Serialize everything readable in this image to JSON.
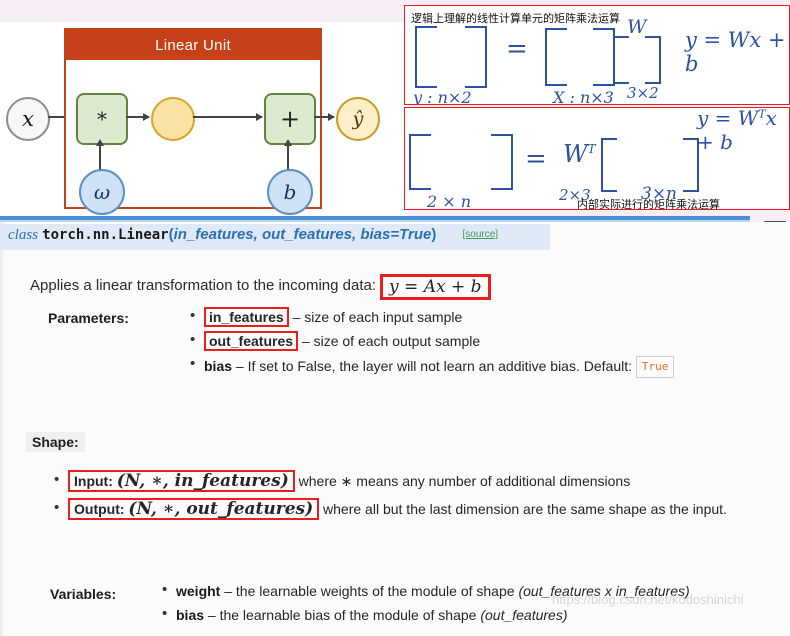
{
  "diagram": {
    "title": "Linear Unit",
    "nodes": {
      "input": "x",
      "multiply": "*",
      "hidden": "",
      "add": "+",
      "output": "ŷ",
      "weight": "ω",
      "bias": "b"
    }
  },
  "notes": {
    "note1": {
      "caption": "逻辑上理解的线性计算单元的矩阵乘法运算",
      "equals": "=",
      "w_label": "W",
      "equation": "y = Wx + b",
      "left_dim": "y : n×2",
      "mid_dim": "X : n×3",
      "right_dim": "3×2"
    },
    "note2": {
      "caption": "内部实际进行的矩阵乘法运算",
      "equals": "=",
      "w_label": "W",
      "w_sup": "T",
      "equation": "y = W",
      "equation_sup": "T",
      "equation_tail": "x + b",
      "left_dim": "2 × n",
      "w_dim": "2×3",
      "right_dim": "3×n"
    }
  },
  "signature": {
    "keyword": "class",
    "path": "torch.nn.Linear",
    "open_paren": "(",
    "args": "in_features, out_features, bias=True",
    "close_paren": ")",
    "source": "[source]"
  },
  "intro": {
    "text": "Applies a linear transformation to the incoming data:",
    "formula": "y = Ax + b"
  },
  "parameters": {
    "label": "Parameters:",
    "items": [
      {
        "name": "in_features",
        "highlight": true,
        "desc": " – size of each input sample"
      },
      {
        "name": "out_features",
        "highlight": true,
        "desc": " – size of each output sample"
      },
      {
        "name": "bias",
        "highlight": false,
        "desc": " – If set to False, the layer will not learn an additive bias. Default: ",
        "badge": "True"
      }
    ]
  },
  "shape": {
    "label": "Shape:",
    "input_prefix": "Input: ",
    "input_formula": "(N, ∗, in_features)",
    "input_desc": " where ∗ means any number of additional dimensions",
    "output_prefix": "Output: ",
    "output_formula": "(N, ∗, out_features)",
    "output_desc": " where all but the last dimension are the same shape as the input."
  },
  "variables": {
    "label": "Variables:",
    "items": [
      {
        "name": "weight",
        "desc": " – the learnable weights of the module of shape ",
        "shape": "(out_features x in_features)"
      },
      {
        "name": "bias",
        "desc": " – the learnable bias of the module of shape ",
        "shape": "(out_features)"
      }
    ]
  },
  "watermark": "https://blog.csdn.net/kodoshinichi"
}
